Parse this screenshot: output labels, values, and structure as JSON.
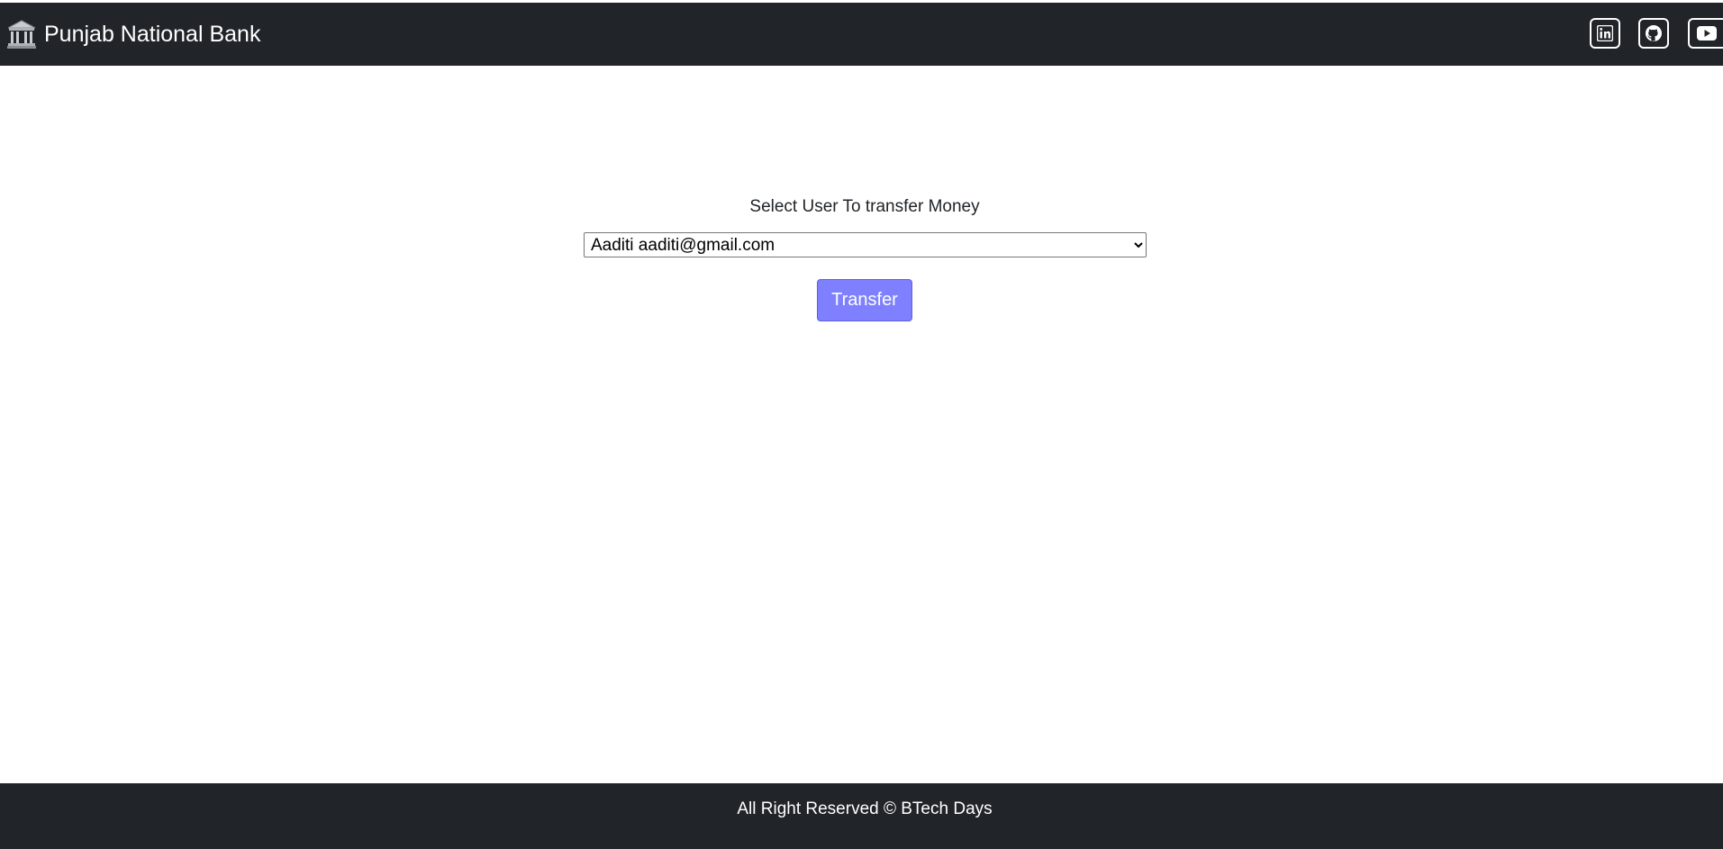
{
  "navbar": {
    "brand_text": "Punjab National Bank",
    "brand_icon": "bank-icon",
    "social_links": [
      {
        "icon": "linkedin-icon"
      },
      {
        "icon": "github-icon"
      },
      {
        "icon": "youtube-icon"
      }
    ],
    "background_color": "#212529"
  },
  "main": {
    "prompt": "Select User To transfer Money",
    "select": {
      "selected_value": "Aaditi  aaditi@gmail.com"
    },
    "transfer_button": {
      "label": "Transfer",
      "color": "#7f80ff"
    }
  },
  "footer": {
    "text": "All Right Reserved © BTech Days"
  }
}
